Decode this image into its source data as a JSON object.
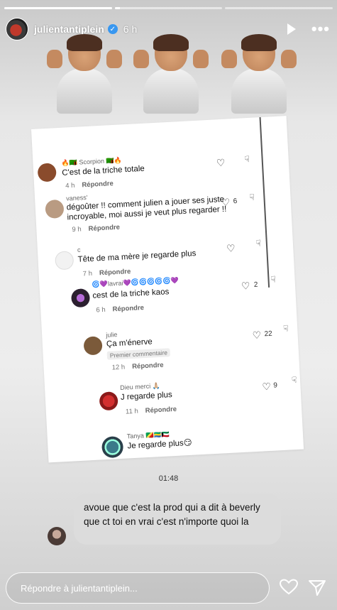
{
  "header": {
    "username": "julientantiplein",
    "time": "6 h",
    "verified_icon": "verified-badge-icon",
    "progress": [
      1,
      0.05,
      0
    ]
  },
  "comments": [
    {
      "user": "🔥🇿🇲 Scorpion 🇿🇲🔥",
      "text": "C'est de la triche totale",
      "time": "4 h",
      "reply": "Répondre",
      "likes": ""
    },
    {
      "user": "vaness'",
      "text": "dégoûter !! comment julien a jouer ses juste incroyable, moi aussi je veut plus regarder !!",
      "time": "9 h",
      "reply": "Répondre",
      "likes": "6"
    },
    {
      "user": "c",
      "text": "Tête de ma mère je regarde plus",
      "time": "7 h",
      "reply": "Répondre",
      "likes": ""
    },
    {
      "user": "🌀💜lavrai💜🌀🌀🌀🌀🌀💜",
      "text": "cest de la triche kaos",
      "time": "6 h",
      "reply": "Répondre",
      "likes": "2"
    },
    {
      "user": "julie",
      "text": "Ça m'énerve",
      "badge": "Premier commentaire",
      "time": "12 h",
      "reply": "Répondre",
      "likes": "22"
    },
    {
      "user": "Dieu merci 🙏🏼",
      "text": "J regarde plus",
      "time": "11 h",
      "reply": "Répondre",
      "likes": "9"
    },
    {
      "user": "Tanya 🇨🇬🇬🇦🇰🇼",
      "text": "Je regarde plus😏",
      "time": "",
      "reply": "",
      "likes": ""
    }
  ],
  "dm": {
    "timestamp": "01:48",
    "message": "avoue que c'est la prod qui a dit à beverly que ct toi en vrai c'est n'importe quoi la"
  },
  "footer": {
    "reply_placeholder": "Répondre à julientantiplein..."
  },
  "colors": {
    "verified": "#3897f0",
    "bubble": "#dcdcdc"
  }
}
